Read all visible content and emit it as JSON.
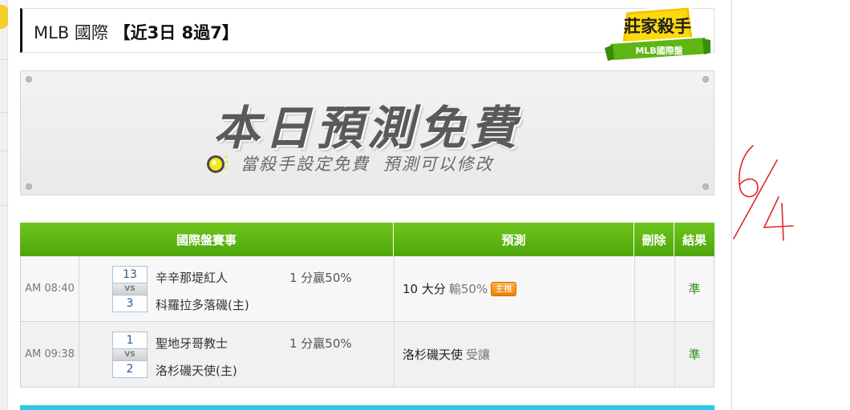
{
  "header": {
    "title": "MLB 國際",
    "record": "【近3日 8過7】",
    "badge_line1": "莊家殺手",
    "badge_line2": "MLB國際盤"
  },
  "banner": {
    "title": "本日預測免費",
    "subtitle": "當殺手設定免費 預測可以修改"
  },
  "table": {
    "headers": {
      "game": "國際盤賽事",
      "prediction": "預測",
      "delete": "刪除",
      "result": "結果"
    },
    "rows": [
      {
        "time": "AM 08:40",
        "score_away": "13",
        "vs": "VS",
        "score_home": "3",
        "team_away": "辛辛那堤紅人",
        "team_home": "科羅拉多落磯(主)",
        "handicap": "1 分贏50%",
        "prediction": "10 大分",
        "prediction_extra": "輸50%",
        "tag": "主推",
        "result": "準"
      },
      {
        "time": "AM 09:38",
        "score_away": "1",
        "vs": "VS",
        "score_home": "2",
        "team_away": "聖地牙哥教士",
        "team_home": "洛杉磯天使(主)",
        "handicap": "1 分贏50%",
        "prediction": "洛杉磯天使",
        "prediction_extra": "受讓",
        "tag": "",
        "result": "準"
      }
    ]
  },
  "annotation": {
    "text": "6/4",
    "color": "#e0262a"
  },
  "colors": {
    "header_green": "#5bb513",
    "result_green": "#2f8a1e",
    "tag_orange": "#f28a0f",
    "cyan_bar": "#2ec8e8"
  }
}
